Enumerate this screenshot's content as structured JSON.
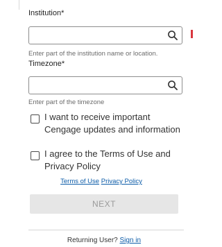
{
  "institution": {
    "label": "Institution*",
    "value": "",
    "hint": "Enter part of the institution name or location."
  },
  "timezone": {
    "label": "Timezone*",
    "value": "",
    "hint": "Enter part of the timezone"
  },
  "consents": {
    "updates_label": "I want to receive important Cengage updates and information",
    "updates_checked": false,
    "terms_label": "I agree to the Terms of Use and Privacy Policy",
    "terms_checked": false
  },
  "links": {
    "terms_of_use": "Terms of Use",
    "privacy_policy": "Privacy Policy"
  },
  "next_button": "NEXT",
  "footer": {
    "returning_prefix": "Returning User?",
    "sign_in": "Sign in"
  },
  "colors": {
    "link": "#0b5ba8",
    "error": "#d9363e",
    "button_disabled_bg": "#e6e6e6"
  }
}
